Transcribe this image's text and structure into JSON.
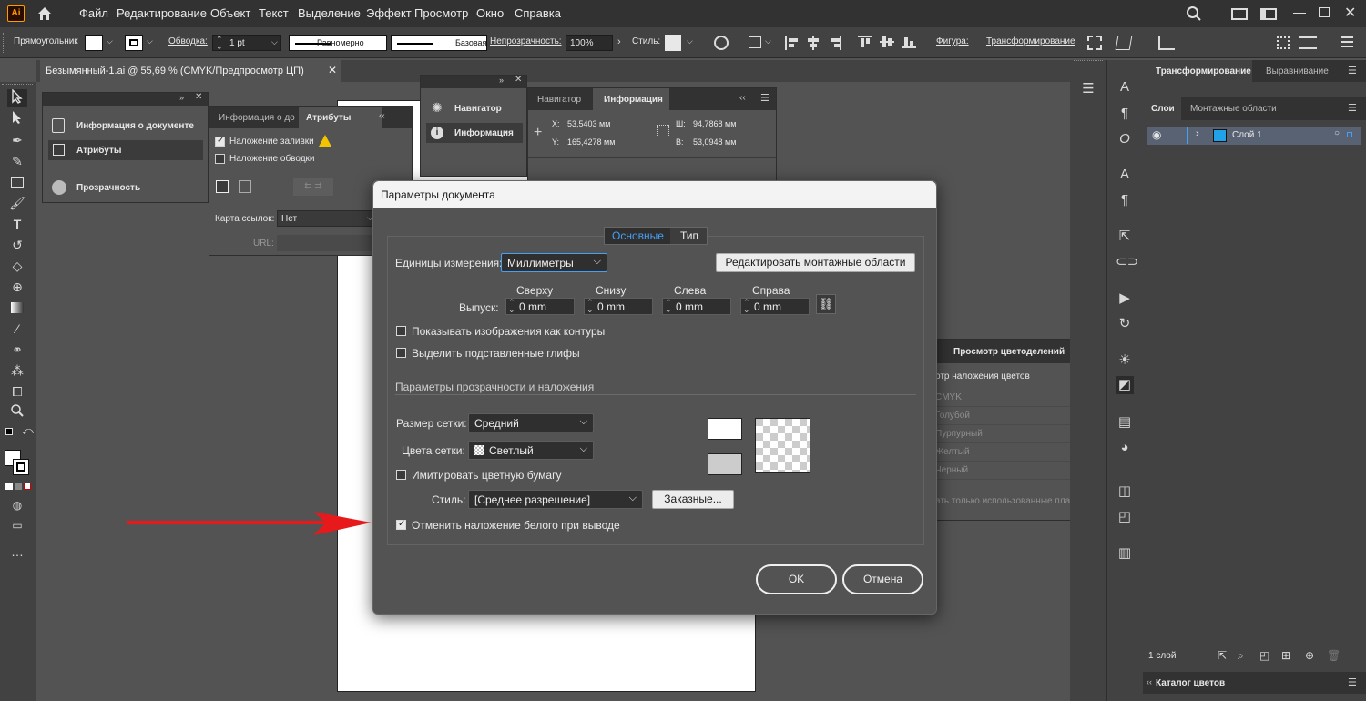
{
  "menu": {
    "logo": "Ai",
    "items": [
      "Файл",
      "Редактирование",
      "Объект",
      "Текст",
      "Выделение",
      "Эффект",
      "Просмотр",
      "Окно",
      "Справка"
    ]
  },
  "control": {
    "tool_name": "Прямоугольник",
    "stroke_label": "Обводка:",
    "stroke_value": "1 pt",
    "profile": "Равномерно",
    "brush": "Базовая",
    "opacity_label": "Непрозрачность:",
    "opacity_value": "100%",
    "style_label": "Стиль:",
    "shape_label": "Фигура:",
    "transform_label": "Трансформирование"
  },
  "document_tab": {
    "title": "Безымянный-1.ai @ 55,69 % (CMYK/Предпросмотр ЦП)"
  },
  "doc_info_panel": {
    "items": [
      "Информация о документе",
      "Атрибуты",
      "Прозрачность"
    ]
  },
  "attributes_panel": {
    "tabs": [
      "Информация о до",
      "Атрибуты"
    ],
    "overprint_fill": "Наложение заливки",
    "overprint_stroke": "Наложение обводки",
    "imagemap_label": "Карта ссылок:",
    "imagemap_value": "Нет",
    "url_label": "URL:"
  },
  "navigator_panel": {
    "items": [
      "Навигатор",
      "Информация"
    ]
  },
  "info_panel": {
    "tabs": [
      "Навигатор",
      "Информация"
    ],
    "x_label": "X:",
    "x_value": "53,5403 мм",
    "y_label": "Y:",
    "y_value": "165,4278 мм",
    "w_label": "Ш:",
    "w_value": "94,7868 мм",
    "h_label": "В:",
    "h_value": "53,0948 мм"
  },
  "separations_panel": {
    "title": "Просмотр цветоделений",
    "overprint": "отр наложения цветов",
    "inks": [
      "CMYK",
      "Голубой",
      "Пурпурный",
      "Желтый",
      "Черный"
    ],
    "footer": "ать только использованные плашечн"
  },
  "dialog": {
    "title": "Параметры документа",
    "tabs": [
      "Основные",
      "Тип"
    ],
    "units_label": "Единицы измерения:",
    "units_value": "Миллиметры",
    "edit_artboards": "Редактировать монтажные области",
    "bleed_label": "Выпуск:",
    "bleed_headers": [
      "Сверху",
      "Снизу",
      "Слева",
      "Справа"
    ],
    "bleed_values": [
      "0 mm",
      "0 mm",
      "0 mm",
      "0 mm"
    ],
    "show_outlines": "Показывать изображения как контуры",
    "highlight_glyphs": "Выделить подставленные глифы",
    "transparency_section": "Параметры прозрачности и наложения",
    "grid_size_label": "Размер сетки:",
    "grid_size_value": "Средний",
    "grid_colors_label": "Цвета сетки:",
    "grid_colors_value": "Светлый",
    "simulate_paper": "Имитировать цветную бумагу",
    "style_label": "Стиль:",
    "style_value": "[Среднее разрешение]",
    "custom_button": "Заказные...",
    "discard_white": "Отменить наложение белого при выводе",
    "ok": "OK",
    "cancel": "Отмена"
  },
  "layers_panel": {
    "tabs": [
      "Трансформирование",
      "Выравнивание"
    ],
    "subtabs": [
      "Слои",
      "Монтажные области"
    ],
    "layer_name": "Слой 1",
    "count": "1 слой",
    "catalog": "Каталог цветов"
  },
  "colors": {
    "arrow": "#e8191b",
    "accent": "#46a0f5",
    "layer_swatch": "#1fa2e8"
  }
}
